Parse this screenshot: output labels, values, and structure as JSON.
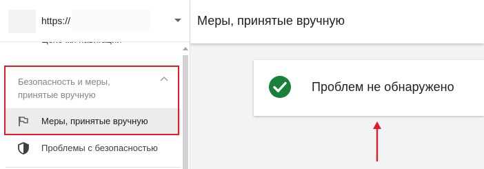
{
  "property": {
    "url": "https://"
  },
  "sidebar": {
    "cut_item": {
      "label": "Цепочки навигации"
    },
    "section": {
      "title": "Безопасность и меры, принятые вручную"
    },
    "items": [
      {
        "label": "Меры, принятые вручную",
        "icon": "flag-icon",
        "active": true
      },
      {
        "label": "Проблемы с безопасностью",
        "icon": "shield-icon",
        "active": false
      }
    ]
  },
  "header": {
    "title": "Меры, принятые вручную"
  },
  "status": {
    "message": "Проблем не обнаружено",
    "icon": "check-circle-icon"
  },
  "colors": {
    "highlight": "#e8191f",
    "success": "#188038",
    "arrow": "#d91e28"
  }
}
